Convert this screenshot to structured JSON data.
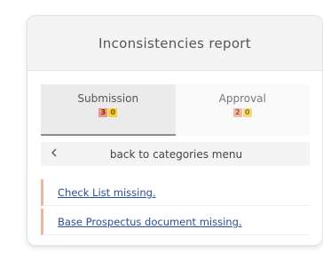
{
  "panel": {
    "title": "Inconsistencies report"
  },
  "tabs": [
    {
      "label": "Submission",
      "active": true,
      "badges": [
        {
          "value": "3",
          "color": "#e9967a"
        },
        {
          "value": "0",
          "color": "#f6cf3e"
        }
      ]
    },
    {
      "label": "Approval",
      "active": false,
      "badges": [
        {
          "value": "2",
          "color": "#f2b9a5"
        },
        {
          "value": "0",
          "color": "#f8dc79"
        }
      ]
    }
  ],
  "back": {
    "icon": "chevron-left-icon",
    "label": "back to categories menu"
  },
  "issues": [
    {
      "label": "Check List missing."
    },
    {
      "label": "Base Prospectus document missing."
    }
  ],
  "colors": {
    "issue_accent": "#f0b3a0",
    "link": "#2a4f96"
  }
}
